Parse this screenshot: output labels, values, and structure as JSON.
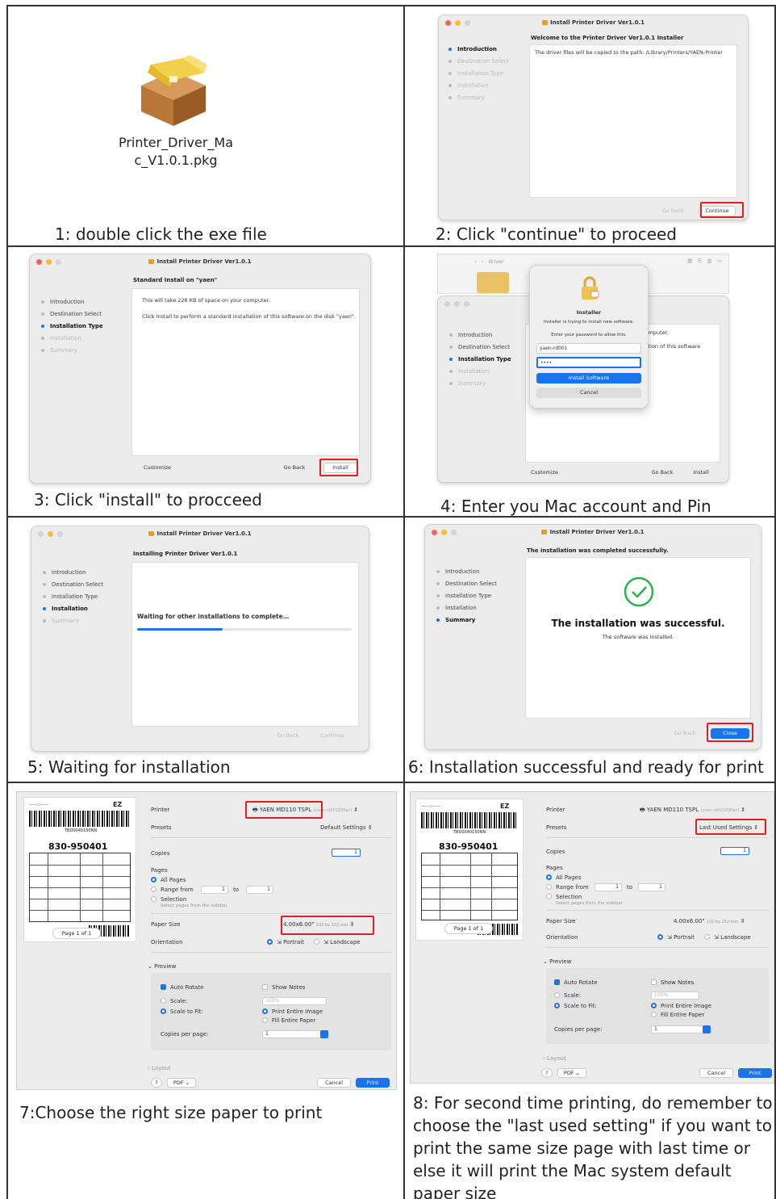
{
  "captions": {
    "c1": "1: double click the exe file",
    "c2": "2: Click \"continue\" to proceed",
    "c3": "3: Click \"install\" to procceed",
    "c4": "4: Enter you Mac account and Pin",
    "c5": "5: Waiting for installation",
    "c6": "6: Installation successful and ready for print",
    "c7": "7:Choose the right size paper to print",
    "c8": "8: For second time printing, do remember to choose the \"last used setting\" if you want to print the same size page with last time or else it will print the Mac system default paper size"
  },
  "pkg_file": {
    "name": "Printer_Driver_Mac_V1.0.1.pkg",
    "line1": "Printer_Driver_Ma",
    "line2": "c_V1.0.1.pkg"
  },
  "installer": {
    "title": "Install Printer Driver Ver1.0.1",
    "steps": [
      "Introduction",
      "Destination Select",
      "Installation Type",
      "Installation",
      "Summary"
    ],
    "s2": {
      "heading": "Welcome to the Printer Driver Ver1.0.1 Installer",
      "body": "The driver files will be copied to the path: /Library/Printers/YAEN-Printer",
      "go_back": "Go Back",
      "continue": "Continue"
    },
    "s3": {
      "heading": "Standard Install on \"yaen\"",
      "body1": "This will take 226 KB of space on your computer.",
      "body2": "Click Install to perform a standard installation of this software on the disk \"yaen\".",
      "customize": "Customize",
      "go_back": "Go Back",
      "install": "Install"
    },
    "s4": {
      "finder_label": "driver",
      "dialog_title": "Installer",
      "dialog_msg": "Installer is trying to install new software.",
      "dialog_prompt": "Enter your password to allow this.",
      "username": "yaen-rd001",
      "password": "••••",
      "install_software": "Install Software",
      "cancel": "Cancel",
      "side1": "computer.",
      "side2": "llation of this software",
      "customize": "Customize",
      "go_back": "Go Back",
      "install": "Install"
    },
    "s5": {
      "heading": "Installing Printer Driver Ver1.0.1",
      "waiting": "Waiting for other installations to complete…",
      "progress": 0.4,
      "go_back": "Go Back",
      "continue": "Continue"
    },
    "s6": {
      "heading": "The installation was completed successfully.",
      "success": "The installation was successful.",
      "sub": "The software was installed.",
      "go_back": "Go Back",
      "close": "Close"
    }
  },
  "print": {
    "printer_label": "Printer",
    "printer_value": "YAEN MD110 TSPL",
    "printer_host": "(yaen-rd001的Mac)",
    "presets_label": "Presets",
    "presets7": "Default Settings",
    "presets8": "Last Used Settings",
    "copies_label": "Copies",
    "copies": "1",
    "pages_label": "Pages",
    "all_pages": "All Pages",
    "range_from": "Range from",
    "range_to": "to",
    "range_a": "1",
    "range_b": "1",
    "selection": "Selection",
    "selection_hint": "Select pages from the sidebar",
    "paper_size_label": "Paper Size",
    "paper_size": "4.00x6.00\"",
    "paper_size_mm": "102 by 152 mm",
    "orientation_label": "Orientation",
    "portrait": "Portrait",
    "landscape": "Landscape",
    "preview_label": "Preview",
    "auto_rotate": "Auto Rotate",
    "show_notes": "Show Notes",
    "scale": "Scale:",
    "scale_value": "100%",
    "scale_to_fit": "Scale to Fit:",
    "print_entire": "Print Entire Image",
    "fill_entire": "Fill Entire Paper",
    "copies_per_page": "Copies per page:",
    "copies_per_page_value": "1",
    "layout": "Layout",
    "help": "?",
    "pdf": "PDF",
    "cancel": "Cancel",
    "print": "Print",
    "page_indicator": "Page 1 of 1"
  },
  "label": {
    "ez": "EZ",
    "number": "830-950401",
    "tracking": "TBD0040150NN"
  }
}
